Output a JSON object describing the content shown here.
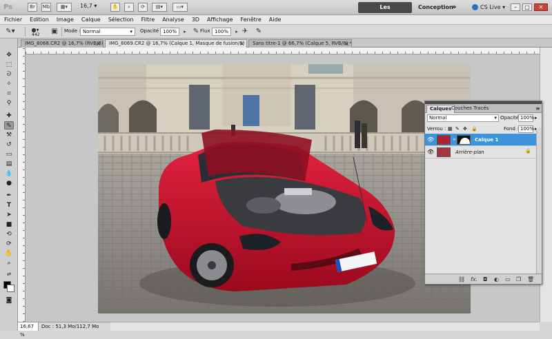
{
  "app": {
    "logo": "Ps",
    "zoom_value": "16,7",
    "workspace_active": "Les indispensables",
    "workspace_other": "Conception",
    "more": "»",
    "cs_live": "CS Live",
    "cs_live_arrow": "▾",
    "win_min": "–",
    "win_max": "□",
    "win_close": "✕"
  },
  "menu": [
    "Fichier",
    "Edition",
    "Image",
    "Calque",
    "Sélection",
    "Filtre",
    "Analyse",
    "3D",
    "Affichage",
    "Fenêtre",
    "Aide"
  ],
  "options": {
    "brush_size": "442",
    "mode_label": "Mode :",
    "mode_value": "Normal",
    "opacity_label": "Opacité :",
    "opacity_value": "100%",
    "flow_label": "Flux :",
    "flow_value": "100%"
  },
  "doc_tabs": [
    {
      "label": "IMG_8068.CR2 @ 16,7% (RVB/8)",
      "active": false
    },
    {
      "label": "IMG_8069.CR2 @ 16,7% (Calque 1, Masque de fusion/8) *",
      "active": true
    },
    {
      "label": "Sans titre-1 @ 66,7% (Calque 5, RVB/8) *",
      "active": false
    }
  ],
  "tab_close": "×",
  "status": {
    "zoom": "16,67 %",
    "doc": "Doc : 51,3 Mo/112,7 Mo"
  },
  "layers_panel": {
    "tabs": [
      "Calques",
      "Couches",
      "Tracés"
    ],
    "blend_mode": "Normal",
    "opacity_label": "Opacité :",
    "opacity_value": "100%",
    "lock_label": "Verrou :",
    "fill_label": "Fond :",
    "fill_value": "100%",
    "layers": [
      {
        "name": "Calque 1",
        "selected": true,
        "has_mask": true
      },
      {
        "name": "Arrière-plan",
        "selected": false,
        "has_mask": false
      }
    ],
    "footer_icons": [
      "link-icon",
      "fx-icon",
      "mask-icon",
      "adjustment-icon",
      "group-icon",
      "new-layer-icon",
      "trash-icon"
    ],
    "footer_fx": "fx."
  },
  "colors": {
    "accent": "#3d94dc",
    "car_red": "#c8102e"
  }
}
